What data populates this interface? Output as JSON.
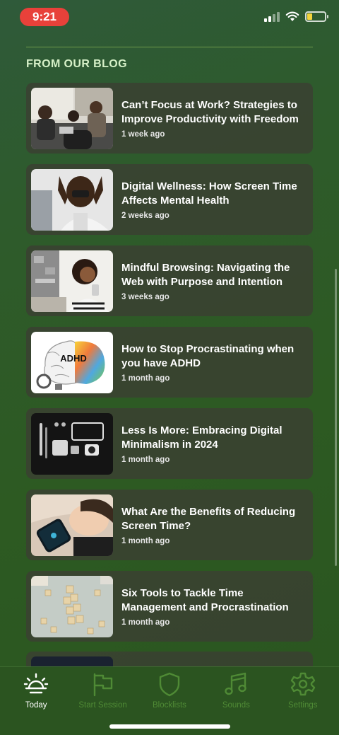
{
  "status_bar": {
    "time": "9:21",
    "battery_level": 0.3,
    "battery_color": "#f2d33c"
  },
  "section_title": "FROM OUR BLOG",
  "posts": [
    {
      "title": "Can’t Focus at Work? Strategies to Improve Productivity with Freedom",
      "time": "1 week ago",
      "image": "office-meeting"
    },
    {
      "title": "Digital Wellness: How Screen Time Affects Mental Health",
      "time": "2 weeks ago",
      "image": "stressed-man"
    },
    {
      "title": "Mindful Browsing: Navigating the Web with Purpose and Intention",
      "time": "3 weeks ago",
      "image": "woman-phone"
    },
    {
      "title": "How to Stop Procrastinating when you have ADHD",
      "time": "1 month ago",
      "image": "adhd-brain",
      "image_text": "ADHD"
    },
    {
      "title": "Less Is More: Embracing Digital Minimalism in 2024",
      "time": "1 month ago",
      "image": "flatlay-gadgets"
    },
    {
      "title": "What Are the Benefits of Reducing Screen Time?",
      "time": "1 month ago",
      "image": "sleeping-with-phone"
    },
    {
      "title": "Six Tools to Tackle Time Management and Procrastination",
      "time": "1 month ago",
      "image": "scrabble-tiles"
    }
  ],
  "tabs": [
    {
      "label": "Today",
      "icon": "sun-icon",
      "active": true
    },
    {
      "label": "Start Session",
      "icon": "flag-icon",
      "active": false
    },
    {
      "label": "Blocklists",
      "icon": "shield-icon",
      "active": false
    },
    {
      "label": "Sounds",
      "icon": "music-note-icon",
      "active": false
    },
    {
      "label": "Settings",
      "icon": "gear-icon",
      "active": false
    }
  ],
  "colors": {
    "accent": "#4f8a35",
    "alert_pill": "#e8413a",
    "card_bg": "#3a4032"
  }
}
